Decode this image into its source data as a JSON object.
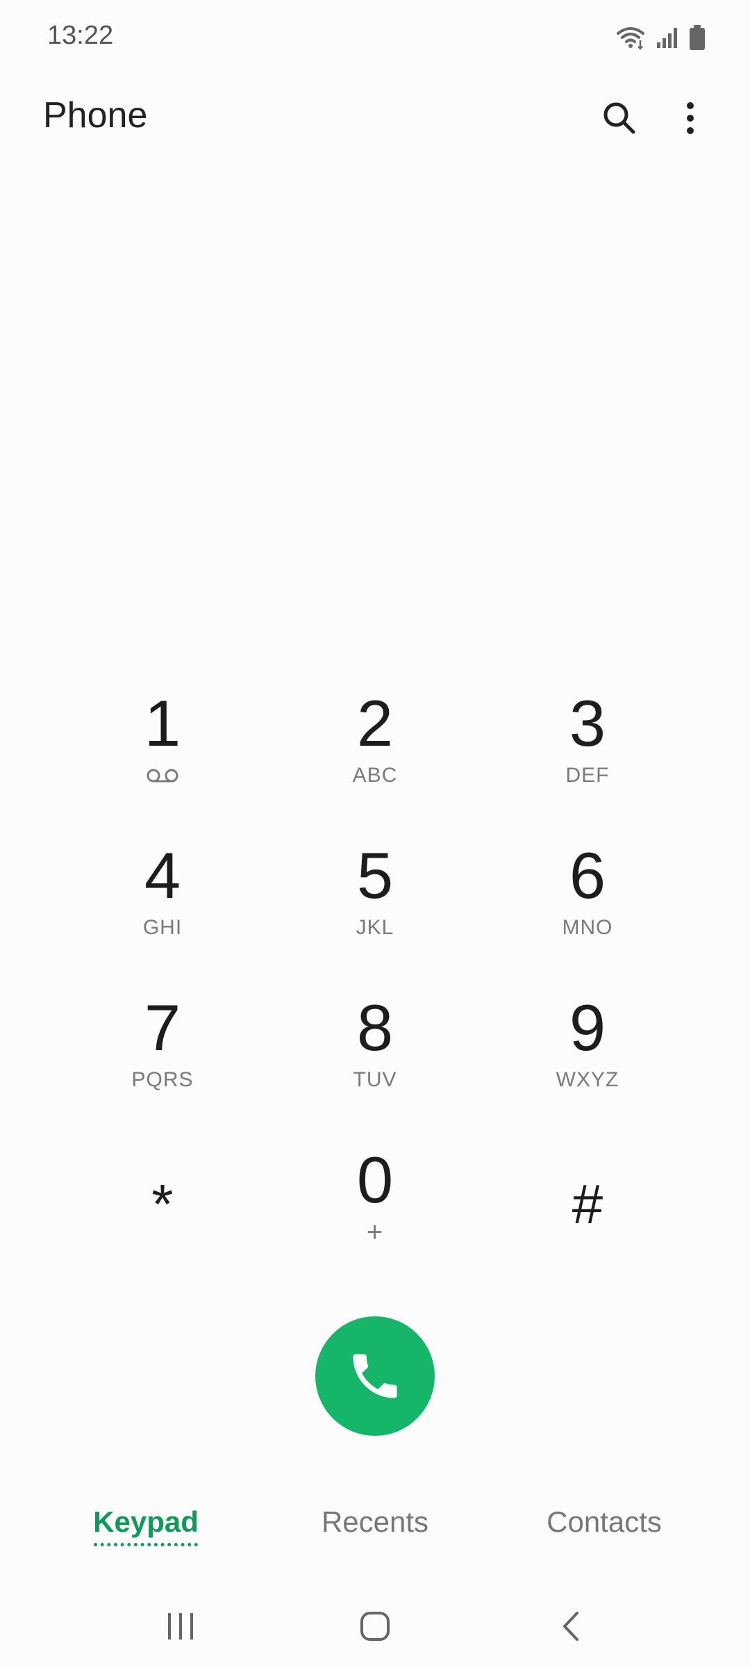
{
  "status_bar": {
    "time": "13:22",
    "icons": [
      "wifi-icon",
      "signal-icon",
      "battery-icon"
    ]
  },
  "header": {
    "title": "Phone",
    "actions": [
      "search-icon",
      "more-options-icon"
    ]
  },
  "keypad": {
    "keys": [
      {
        "digit": "1",
        "letters": "",
        "sub_icon": "voicemail-icon"
      },
      {
        "digit": "2",
        "letters": "ABC"
      },
      {
        "digit": "3",
        "letters": "DEF"
      },
      {
        "digit": "4",
        "letters": "GHI"
      },
      {
        "digit": "5",
        "letters": "JKL"
      },
      {
        "digit": "6",
        "letters": "MNO"
      },
      {
        "digit": "7",
        "letters": "PQRS"
      },
      {
        "digit": "8",
        "letters": "TUV"
      },
      {
        "digit": "9",
        "letters": "WXYZ"
      },
      {
        "digit": "*",
        "letters": ""
      },
      {
        "digit": "0",
        "letters": "+"
      },
      {
        "digit": "#",
        "letters": ""
      }
    ]
  },
  "call_button": {
    "icon": "phone-icon",
    "color": "#16b66a"
  },
  "tabs": [
    {
      "label": "Keypad",
      "active": true
    },
    {
      "label": "Recents",
      "active": false
    },
    {
      "label": "Contacts",
      "active": false
    }
  ],
  "nav_bar": {
    "icons": [
      "recent-apps-icon",
      "home-icon",
      "back-icon"
    ]
  },
  "colors": {
    "accent": "#0f9a5a",
    "call_green": "#16b66a"
  }
}
